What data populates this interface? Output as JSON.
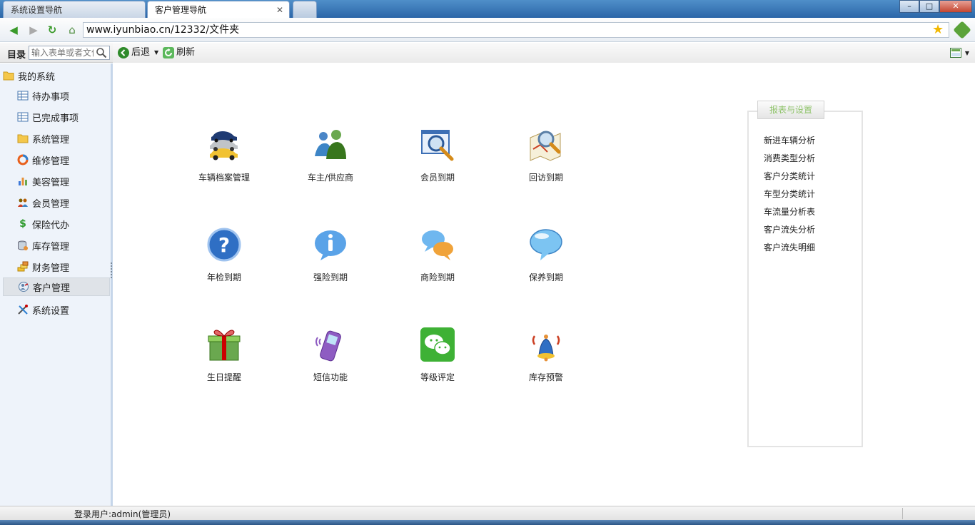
{
  "tabs": {
    "inactive_label": "系统设置导航",
    "active_label": "客户管理导航",
    "close_glyph": "✕"
  },
  "window": {
    "minimize": "–",
    "maximize": "□",
    "close": "✕"
  },
  "address": {
    "url": "www.iyunbiao.cn/12332/文件夹"
  },
  "sidebar": {
    "header_label": "目录",
    "search_placeholder": "输入表单或者文件",
    "root_label": "我的系统",
    "items": [
      {
        "label": "待办事项",
        "icon": "grid-icon"
      },
      {
        "label": "已完成事项",
        "icon": "grid-icon"
      },
      {
        "label": "系统管理",
        "icon": "folder-icon"
      },
      {
        "label": "维修管理",
        "icon": "ring-icon"
      },
      {
        "label": "美容管理",
        "icon": "bar-chart-icon"
      },
      {
        "label": "会员管理",
        "icon": "group-icon"
      },
      {
        "label": "保险代办",
        "icon": "dollar-icon"
      },
      {
        "label": "库存管理",
        "icon": "database-icon"
      },
      {
        "label": "财务管理",
        "icon": "coins-icon"
      },
      {
        "label": "客户管理",
        "icon": "customer-icon",
        "selected": true
      },
      {
        "label": "系统设置",
        "icon": "tools-icon"
      }
    ]
  },
  "toolbar": {
    "back_label": "后退",
    "refresh_label": "刷新"
  },
  "tiles": [
    {
      "label": "车辆档案管理",
      "icon": "cars-icon"
    },
    {
      "label": "车主/供应商",
      "icon": "people-icon"
    },
    {
      "label": "会员到期",
      "icon": "magnifier-window-icon"
    },
    {
      "label": "回访到期",
      "icon": "map-search-icon"
    },
    {
      "label": "年检到期",
      "icon": "question-icon"
    },
    {
      "label": "强险到期",
      "icon": "info-bubble-icon"
    },
    {
      "label": "商险到期",
      "icon": "chat-bubbles-icon"
    },
    {
      "label": "保养到期",
      "icon": "speech-bubble-icon"
    },
    {
      "label": "生日提醒",
      "icon": "gift-icon"
    },
    {
      "label": "短信功能",
      "icon": "phone-icon"
    },
    {
      "label": "等级评定",
      "icon": "wechat-icon"
    },
    {
      "label": "库存预警",
      "icon": "bell-icon"
    }
  ],
  "reports": {
    "title": "报表与设置",
    "items": [
      "新进车辆分析",
      "消费类型分析",
      "客户分类统计",
      "车型分类统计",
      "车流量分析表",
      "客户流失分析",
      "客户流失明细"
    ]
  },
  "status": {
    "user": "登录用户:admin(管理员)"
  }
}
